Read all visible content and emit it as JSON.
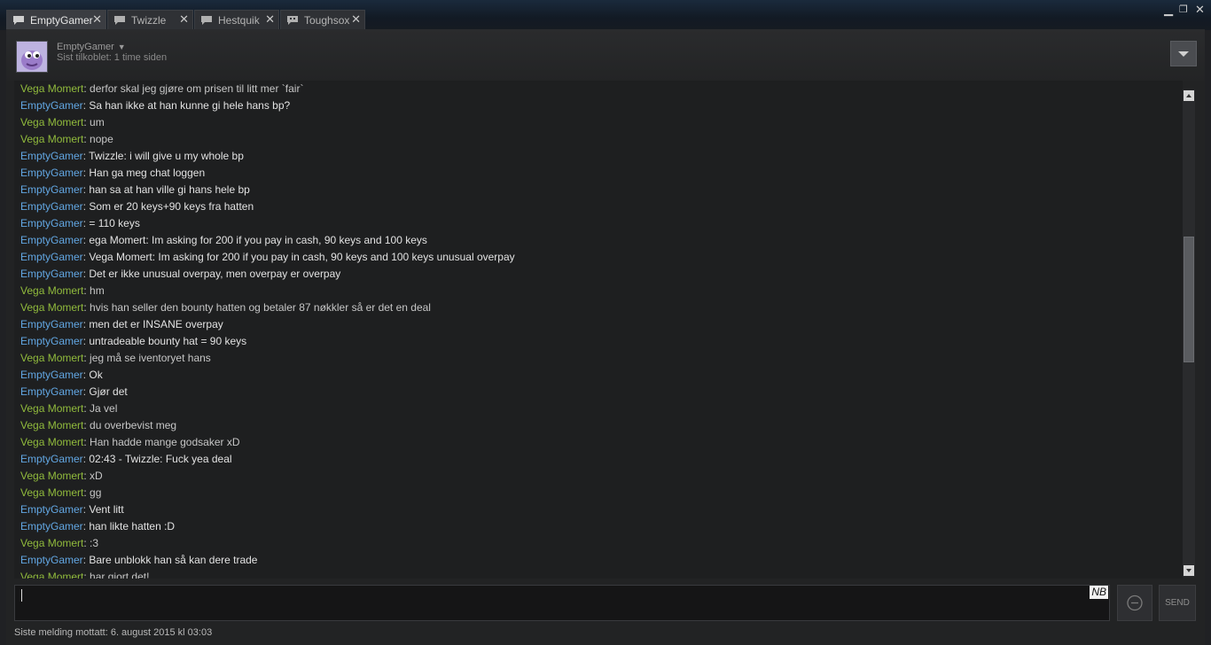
{
  "tabs": [
    {
      "label": "EmptyGamer",
      "active": true
    },
    {
      "label": "Twizzle",
      "active": false
    },
    {
      "label": "Hestquik",
      "active": false
    },
    {
      "label": "Toughsox",
      "active": false
    }
  ],
  "header": {
    "username": "EmptyGamer",
    "last_online": "Sist tilkoblet: 1 time siden"
  },
  "messages": [
    {
      "from": "Vega Momert",
      "text": "derfor skal jeg gjøre om prisen til litt mer `fair`"
    },
    {
      "from": "EmptyGamer",
      "text": "Sa han ikke at han kunne gi hele hans bp?"
    },
    {
      "from": "Vega Momert",
      "text": "um"
    },
    {
      "from": "Vega Momert",
      "text": "nope"
    },
    {
      "from": "EmptyGamer",
      "text": "Twizzle: i will give u my whole bp"
    },
    {
      "from": "EmptyGamer",
      "text": "Han ga meg chat loggen"
    },
    {
      "from": "EmptyGamer",
      "text": "han sa at han ville gi hans hele bp"
    },
    {
      "from": "EmptyGamer",
      "text": "Som er 20 keys+90 keys fra hatten"
    },
    {
      "from": "EmptyGamer",
      "text": "= 110 keys"
    },
    {
      "from": "EmptyGamer",
      "text": "ega Momert: Im asking for 200 if you pay in cash, 90 keys and 100 keys"
    },
    {
      "from": "EmptyGamer",
      "text": "Vega Momert: Im asking for 200 if you pay in cash, 90 keys and 100 keys unusual overpay"
    },
    {
      "from": "EmptyGamer",
      "text": "Det er ikke unusual overpay, men overpay er overpay"
    },
    {
      "from": "Vega Momert",
      "text": "hm"
    },
    {
      "from": "Vega Momert",
      "text": "hvis han seller den bounty hatten og betaler 87 nøkkler så er det en deal"
    },
    {
      "from": "EmptyGamer",
      "text": "men det er INSANE overpay"
    },
    {
      "from": "EmptyGamer",
      "text": "untradeable bounty hat = 90 keys"
    },
    {
      "from": "Vega Momert",
      "text": "jeg må se iventoryet hans"
    },
    {
      "from": "EmptyGamer",
      "text": "Ok"
    },
    {
      "from": "EmptyGamer",
      "text": "Gjør det"
    },
    {
      "from": "Vega Momert",
      "text": "Ja vel"
    },
    {
      "from": "Vega Momert",
      "text": "du overbevist meg"
    },
    {
      "from": "Vega Momert",
      "text": "Han hadde mange godsaker xD"
    },
    {
      "from": "EmptyGamer",
      "text": "02:43 - Twizzle: Fuck yea deal"
    },
    {
      "from": "Vega Momert",
      "text": "xD"
    },
    {
      "from": "Vega Momert",
      "text": "gg"
    },
    {
      "from": "EmptyGamer",
      "text": "Vent litt"
    },
    {
      "from": "EmptyGamer",
      "text": "han likte hatten :D"
    },
    {
      "from": "Vega Momert",
      "text": ":3"
    },
    {
      "from": "EmptyGamer",
      "text": "Bare unblokk han så kan dere trade"
    },
    {
      "from": "Vega Momert",
      "text": "har gjort det!"
    }
  ],
  "composer": {
    "value": "",
    "nb_label": "NB",
    "send_label": "SEND"
  },
  "footer": {
    "last_message": "Siste melding mottatt: 6. august 2015 kl 03:03"
  },
  "colors": {
    "vega_name": "#90ba3c",
    "empty_name": "#62a7e3",
    "background": "#202124"
  },
  "icons": [
    "chat-bubble-icon",
    "close-icon",
    "minimize-icon",
    "restore-icon",
    "window-close-icon",
    "chevron-down-icon",
    "emoticon-icon"
  ]
}
